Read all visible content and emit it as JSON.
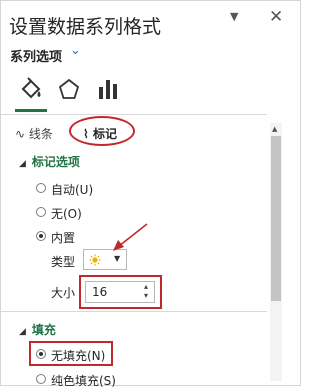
{
  "header": {
    "title": "设置数据系列格式",
    "chevron": "▼",
    "close": "✕"
  },
  "series_options": {
    "label": "系列选项",
    "chevron": "⌄"
  },
  "icon_tabs": [
    {
      "name": "fill-line-icon"
    },
    {
      "name": "effects-pentagon-icon"
    },
    {
      "name": "series-options-bar-icon"
    }
  ],
  "subtabs": {
    "line_label": "线条",
    "marker_label": "标记"
  },
  "marker_options": {
    "heading": "标记选项",
    "options": [
      {
        "label": "自动(U)",
        "checked": false
      },
      {
        "label": "无(O)",
        "checked": false
      },
      {
        "label": "内置",
        "checked": true
      }
    ],
    "type_label": "类型",
    "type_value_icon": "sun-marker-icon",
    "size_label": "大小",
    "size_value": "16"
  },
  "fill": {
    "heading": "填充",
    "options": [
      {
        "label": "无填充(N)",
        "checked": true
      },
      {
        "label": "纯色填充(S)",
        "checked": false
      }
    ]
  },
  "colors": {
    "accent": "#217346",
    "annotation": "#c1272d",
    "link": "#2f6fb5"
  }
}
